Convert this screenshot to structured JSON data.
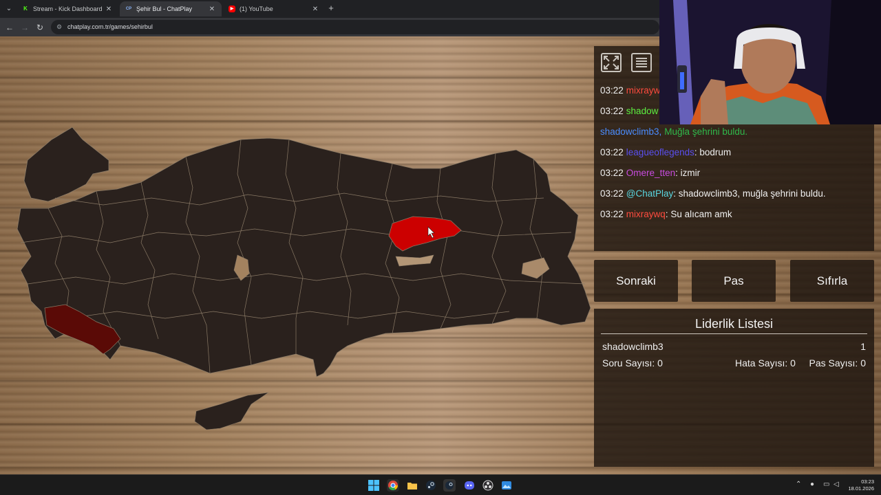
{
  "browser": {
    "tabs": [
      {
        "title": "Stream - Kick Dashboard",
        "favicon": "kick-icon",
        "color": "#53fc18",
        "glyph": "K"
      },
      {
        "title": "Şehir Bul - ChatPlay",
        "favicon": "chatplay-icon",
        "color": "#8ab4f8",
        "glyph": "CP"
      },
      {
        "title": "(1) YouTube",
        "favicon": "youtube-icon",
        "color": "#ff0000",
        "glyph": "▶"
      }
    ],
    "active_tab": 1,
    "url": "chatplay.com.tr/games/sehirbul"
  },
  "chat": {
    "messages": [
      {
        "time": "03:22",
        "user": "mixrayw",
        "user_color": "#ff4b3e",
        "text": ""
      },
      {
        "time": "03:22",
        "user": "shadow",
        "user_color": "#5cf040",
        "text": ""
      },
      {
        "time": "",
        "user": "shadowclimb3,",
        "user_color": "#4a8cff",
        "text": "Muğla şehrini buldu.",
        "text_color": "#2fb84a"
      },
      {
        "time": "03:22",
        "user": "leagueoflegends",
        "user_color": "#5a4ff0",
        "text": ": bodrum"
      },
      {
        "time": "03:22",
        "user": "Omere_tten",
        "user_color": "#c94ce0",
        "text": ": izmir"
      },
      {
        "time": "03:22",
        "user": "@ChatPlay",
        "user_color": "#59d6e0",
        "text": ": shadowclimb3, muğla şehrini buldu."
      },
      {
        "time": "03:22",
        "user": "mixraywq",
        "user_color": "#ff4b3e",
        "text": ": Su alıcam amk"
      }
    ]
  },
  "controls": {
    "next": "Sonraki",
    "pass": "Pas",
    "reset": "Sıfırla"
  },
  "leaderboard": {
    "title": "Liderlik Listesi",
    "player": "shadowclimb3",
    "score": "1",
    "question_count": "Soru Sayısı: 0",
    "error_count": "Hata Sayısı: 0",
    "pass_count": "Pas Sayısı: 0"
  },
  "map": {
    "highlight_color": "#cc0000",
    "found_color": "#5a0a06",
    "land_color": "#2a211d",
    "border_color": "#8a7a66"
  },
  "taskbar": {
    "time": "03:23",
    "date": "18.01.2026"
  }
}
